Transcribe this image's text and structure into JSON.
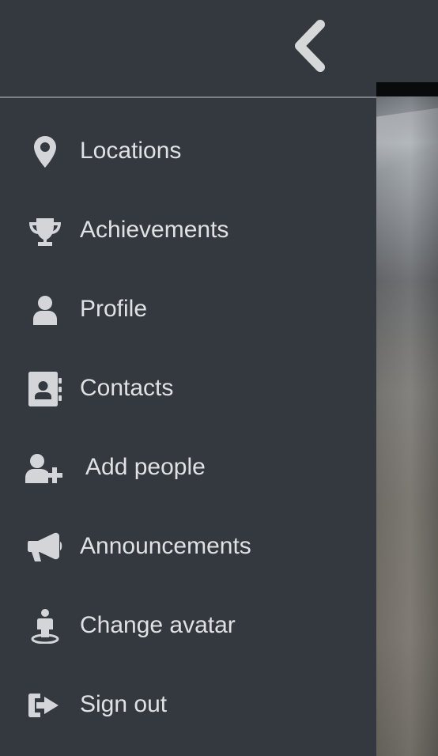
{
  "sidebar": {
    "collapse_icon": "chevron-left-icon",
    "items": [
      {
        "label": "Locations",
        "icon": "map-marker-icon"
      },
      {
        "label": "Achievements",
        "icon": "trophy-icon"
      },
      {
        "label": "Profile",
        "icon": "user-icon"
      },
      {
        "label": "Contacts",
        "icon": "address-book-icon"
      },
      {
        "label": "Add people",
        "icon": "user-plus-icon"
      },
      {
        "label": "Announcements",
        "icon": "bullhorn-icon"
      },
      {
        "label": "Change avatar",
        "icon": "avatar-stand-icon"
      },
      {
        "label": "Sign out",
        "icon": "sign-out-icon"
      }
    ]
  },
  "colors": {
    "sidebar_background": "#343940",
    "text": "#e0e1e3",
    "icon": "#d3d5d8",
    "divider": "#7b8087"
  }
}
